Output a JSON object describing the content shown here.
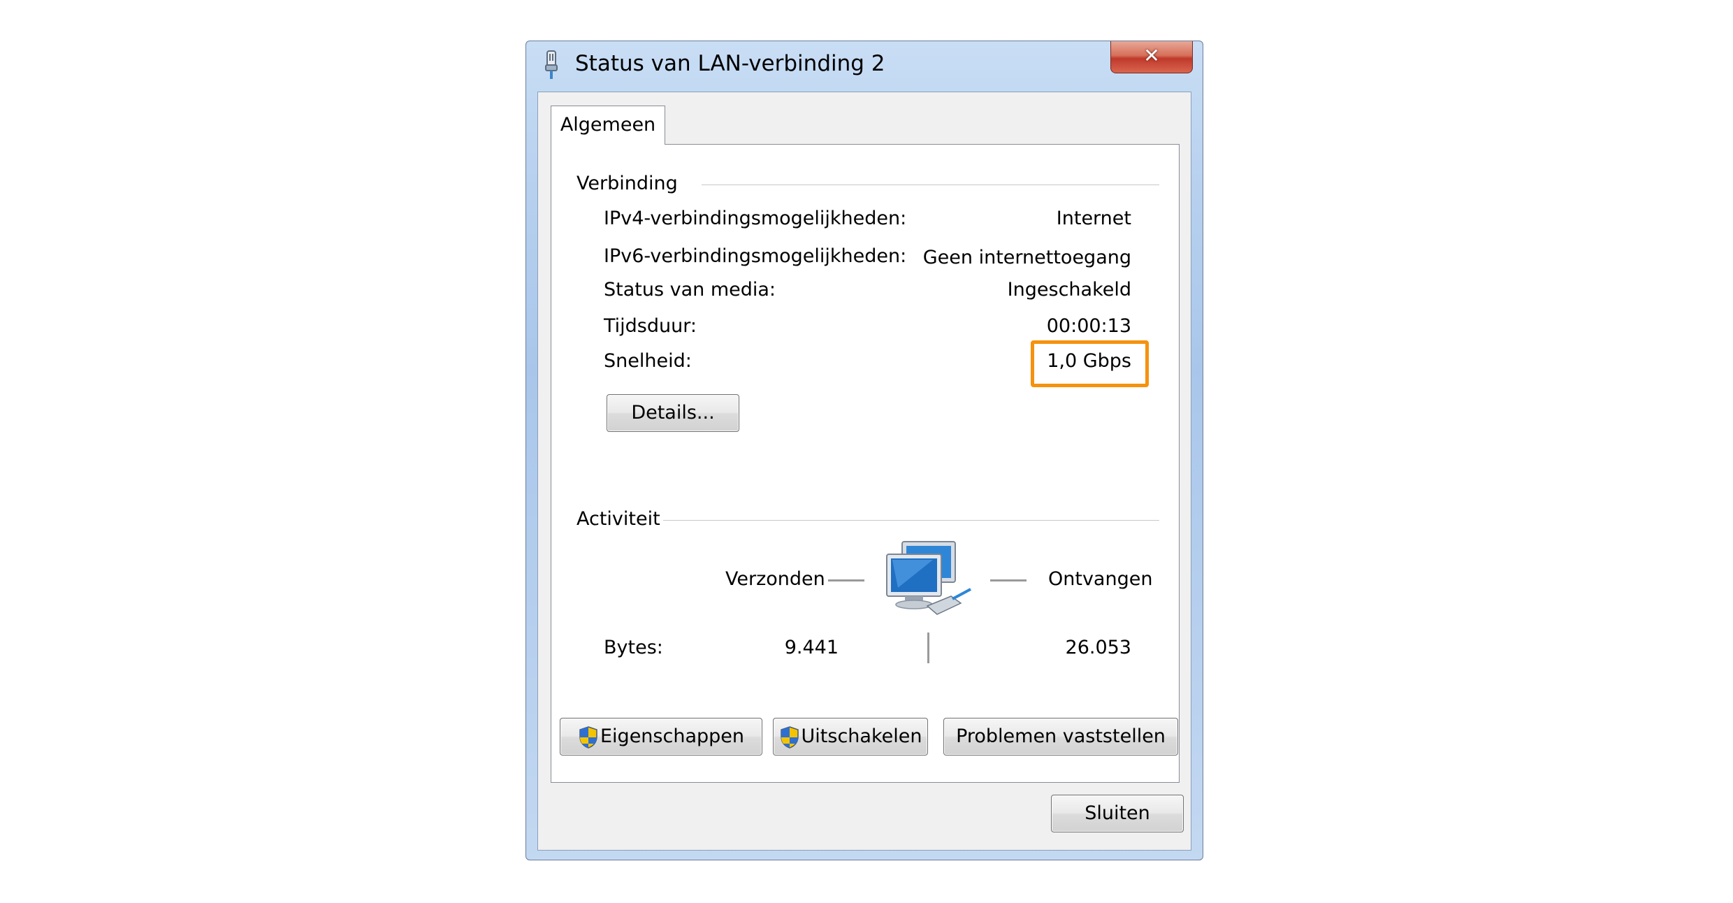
{
  "window": {
    "title": "Status van LAN-verbinding 2",
    "close_glyph": "✕",
    "title_icon": "network-adapter-icon"
  },
  "tabs": [
    {
      "label": "Algemeen",
      "selected": true
    }
  ],
  "connection": {
    "group_title": "Verbinding",
    "rows": [
      {
        "label": "IPv4-verbindingsmogelijkheden:",
        "value": "Internet"
      },
      {
        "label": "IPv6-verbindingsmogelijkheden:",
        "value": "Geen internettoegang"
      },
      {
        "label": "Status van media:",
        "value": "Ingeschakeld"
      },
      {
        "label": "Tijdsduur:",
        "value": "00:00:13"
      },
      {
        "label": "Snelheid:",
        "value": "1,0 Gbps"
      }
    ],
    "details_button": "Details..."
  },
  "activity": {
    "group_title": "Activiteit",
    "sent_label": "Verzonden",
    "received_label": "Ontvangen",
    "bytes_label": "Bytes:",
    "bytes_sent": "9.441",
    "bytes_received": "26.053",
    "icon": "network-computers-icon"
  },
  "buttons": {
    "properties": "Eigenschappen",
    "disable": "Uitschakelen",
    "diagnose": "Problemen vaststellen",
    "close": "Sluiten"
  },
  "colors": {
    "highlight": "#f5920e",
    "close_button": "#c0392b",
    "title_gradient": "#b7d0ee"
  }
}
